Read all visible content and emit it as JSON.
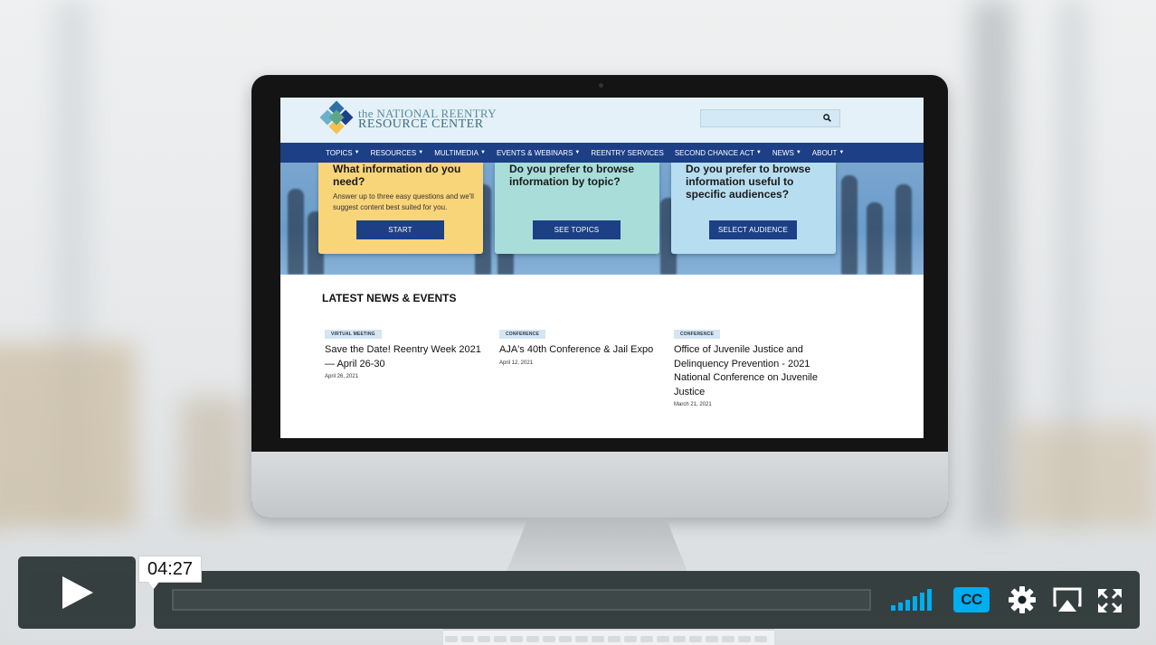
{
  "site": {
    "logo_line1": "the NATIONAL REENTRY",
    "logo_line2": "RESOURCE CENTER",
    "search_placeholder": ""
  },
  "nav": [
    {
      "label": "TOPICS",
      "dropdown": true
    },
    {
      "label": "RESOURCES",
      "dropdown": true
    },
    {
      "label": "MULTIMEDIA",
      "dropdown": true
    },
    {
      "label": "EVENTS & WEBINARS",
      "dropdown": true
    },
    {
      "label": "REENTRY SERVICES",
      "dropdown": false
    },
    {
      "label": "SECOND CHANCE ACT",
      "dropdown": true
    },
    {
      "label": "NEWS",
      "dropdown": true
    },
    {
      "label": "ABOUT",
      "dropdown": true
    }
  ],
  "cards": [
    {
      "question": "What information do you need?",
      "subtext": "Answer up to three easy questions and we'll suggest content best suited for you.",
      "button": "START",
      "color": "#f9d57a"
    },
    {
      "question": "Do you prefer to browse information by topic?",
      "subtext": "",
      "button": "SEE TOPICS",
      "color": "#a8ddd9"
    },
    {
      "question": "Do you prefer to browse information useful to specific audiences?",
      "subtext": "",
      "button": "SELECT AUDIENCE",
      "color": "#b7def0"
    }
  ],
  "news": {
    "title": "LATEST NEWS & EVENTS",
    "items": [
      {
        "tag": "VIRTUAL MEETING",
        "headline": "Save the Date! Reentry Week 2021 — April 26-30",
        "date": "April 26, 2021"
      },
      {
        "tag": "CONFERENCE",
        "headline": "AJA's 40th Conference & Jail Expo",
        "date": "April 12, 2021"
      },
      {
        "tag": "CONFERENCE",
        "headline": "Office of Juvenile Justice and Delinquency Prevention - 2021 National Conference on Juvenile Justice",
        "date": "March 21, 2021"
      }
    ]
  },
  "player": {
    "time": "04:27",
    "cc_label": "CC",
    "icons": [
      "play-icon",
      "volume-icon",
      "cc-icon",
      "gear-icon",
      "airplay-icon",
      "fullscreen-icon"
    ],
    "accent": "#00adef"
  },
  "colors": {
    "nav_bg": "#1c3f86",
    "header_bg": "#e4f1f8",
    "button_bg": "#1c3f86"
  }
}
